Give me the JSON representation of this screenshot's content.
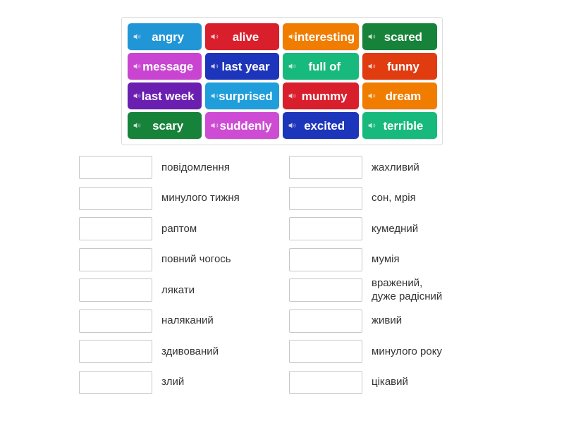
{
  "tiles": {
    "icon_name": "speaker-icon",
    "rows": [
      [
        {
          "label": "angry",
          "color": "#2196d6"
        },
        {
          "label": "alive",
          "color": "#d91f2b"
        },
        {
          "label": "interesting",
          "color": "#f07d00"
        },
        {
          "label": "scared",
          "color": "#17823a"
        }
      ],
      [
        {
          "label": "message",
          "color": "#c945d1"
        },
        {
          "label": "last year",
          "color": "#1d35ba"
        },
        {
          "label": "full of",
          "color": "#18b97c"
        },
        {
          "label": "funny",
          "color": "#e03c10"
        }
      ],
      [
        {
          "label": "last week",
          "color": "#6b1fb0"
        },
        {
          "label": "surprised",
          "color": "#1f9edb"
        },
        {
          "label": "mummy",
          "color": "#d91f2b"
        },
        {
          "label": "dream",
          "color": "#f07d00"
        }
      ],
      [
        {
          "label": "scary",
          "color": "#17823a"
        },
        {
          "label": "suddenly",
          "color": "#ce4cd4"
        },
        {
          "label": "excited",
          "color": "#1d35ba"
        },
        {
          "label": "terrible",
          "color": "#18b97c"
        }
      ]
    ]
  },
  "answers": {
    "left": [
      {
        "text": "повідомлення"
      },
      {
        "text": "минулого тижня"
      },
      {
        "text": "раптом"
      },
      {
        "text": "повний чогось"
      },
      {
        "text": "лякати"
      },
      {
        "text": "наляканий"
      },
      {
        "text": "здивований"
      },
      {
        "text": "злий"
      }
    ],
    "right": [
      {
        "text": "жахливий"
      },
      {
        "text": "сон, мрія"
      },
      {
        "text": "кумедний"
      },
      {
        "text": "мумія"
      },
      {
        "text": "вражений,\nдуже радісний"
      },
      {
        "text": "живий"
      },
      {
        "text": "минулого року"
      },
      {
        "text": "цікавий"
      }
    ]
  }
}
